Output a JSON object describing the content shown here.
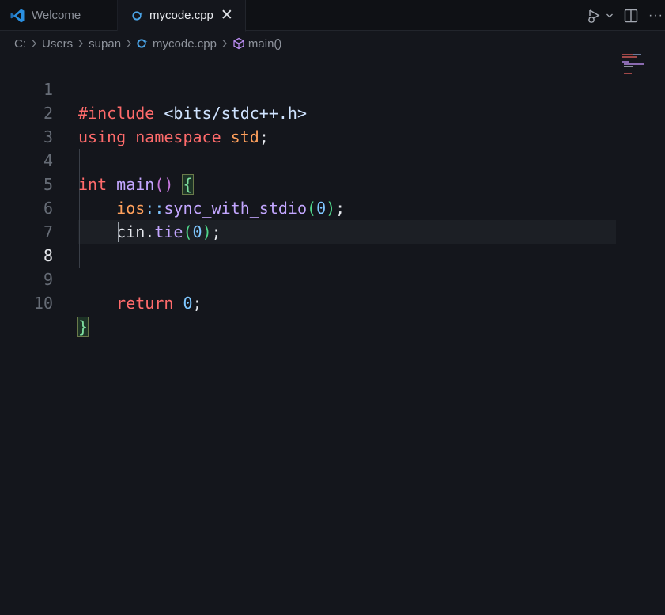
{
  "tabs": [
    {
      "label": "Welcome",
      "icon": "vscode-logo-icon",
      "active": false
    },
    {
      "label": "mycode.cpp",
      "icon": "cpp-file-icon",
      "active": true
    }
  ],
  "breadcrumb": {
    "parts": [
      "C:",
      "Users",
      "supan"
    ],
    "file": "mycode.cpp",
    "symbol": "main()"
  },
  "editor": {
    "active_line": 8,
    "line_numbers": [
      "1",
      "2",
      "3",
      "4",
      "5",
      "6",
      "7",
      "8",
      "9",
      "10"
    ],
    "lines": {
      "l1_a": "#include",
      "l1_b": " <bits/stdc++.h>",
      "l2_a": "using",
      "l2_b": " namespace",
      "l2_c": " std",
      "l2_d": ";",
      "l4_a": "int",
      "l4_b": " main",
      "l4_c": "()",
      "l4_d": " ",
      "l4_e": "{",
      "l5_a": "    ios",
      "l5_b": "::",
      "l5_c": "sync_with_stdio",
      "l5_d": "(",
      "l5_e": "0",
      "l5_f": ")",
      "l5_g": ";",
      "l6_a": "    cin",
      "l6_b": ".",
      "l6_c": "tie",
      "l6_d": "(",
      "l6_e": "0",
      "l6_f": ")",
      "l6_g": ";",
      "l9_a": "    return",
      "l9_b": " 0",
      "l9_c": ";",
      "l10_a": "}"
    }
  },
  "colors": {
    "background": "#14161c",
    "keyword": "#ff6b6b",
    "function": "#c3a6ff",
    "number": "#7fc7ff",
    "namespace": "#ffa05c"
  }
}
